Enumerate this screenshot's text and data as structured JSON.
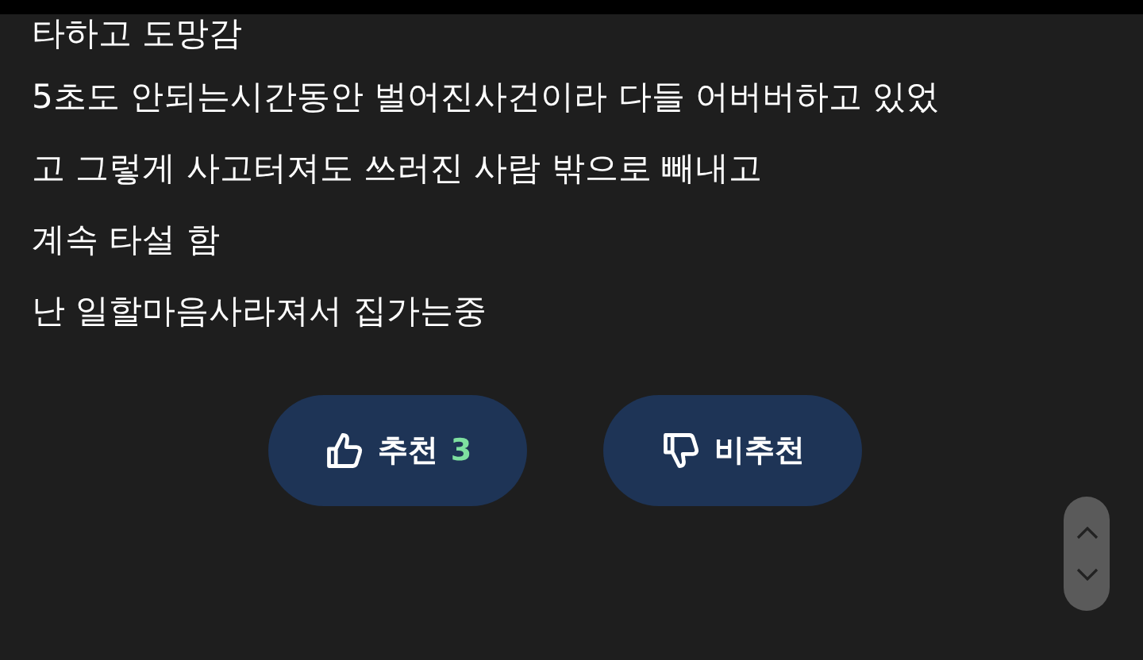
{
  "post": {
    "lines": [
      "타하고 도망감",
      "5초도 안되는시간동안 벌어진사건이라 다들 어버버하고 있었",
      "고 그렇게 사고터져도 쓰러진 사람 밖으로 빼내고",
      "계속 타설 함",
      "난 일할마음사라져서 집가는중"
    ]
  },
  "votes": [
    {
      "kind": "up",
      "label": "추천",
      "count": "3"
    },
    {
      "kind": "down",
      "label": "비추천"
    }
  ]
}
